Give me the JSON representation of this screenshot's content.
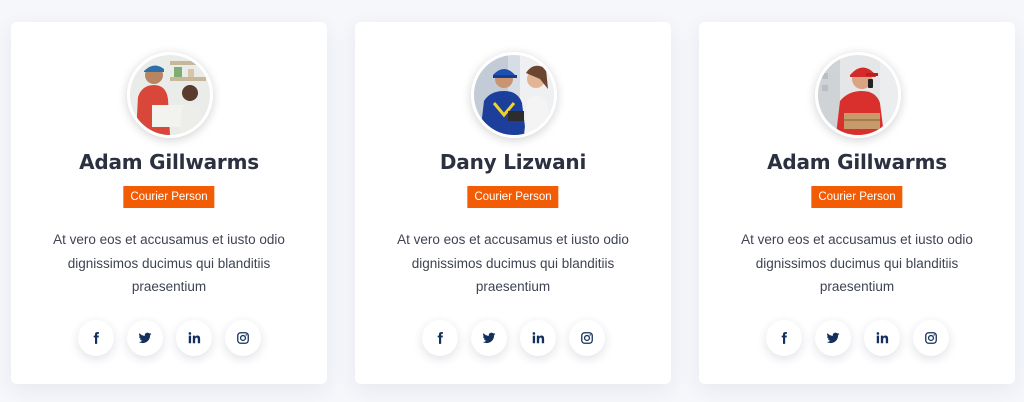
{
  "colors": {
    "accent": "#f25c05",
    "heading": "#2b3140",
    "text": "#3e4452",
    "icon": "#13305c"
  },
  "members": [
    {
      "name": "Adam Gillwarms",
      "role": "Courier Person",
      "description": "At vero eos et accusamus et iusto odio dignissimos ducimus qui blanditiis praesentium",
      "photo_icon": "courier-photo",
      "socials": [
        "facebook-icon",
        "twitter-icon",
        "linkedin-icon",
        "instagram-icon"
      ]
    },
    {
      "name": "Dany Lizwani",
      "role": "Courier Person",
      "description": "At vero eos et accusamus et iusto odio dignissimos ducimus qui blanditiis praesentium",
      "photo_icon": "courier-photo",
      "socials": [
        "facebook-icon",
        "twitter-icon",
        "linkedin-icon",
        "instagram-icon"
      ]
    },
    {
      "name": "Adam Gillwarms",
      "role": "Courier Person",
      "description": "At vero eos et accusamus et iusto odio dignissimos ducimus qui blanditiis praesentium",
      "photo_icon": "courier-photo",
      "socials": [
        "facebook-icon",
        "twitter-icon",
        "linkedin-icon",
        "instagram-icon"
      ]
    }
  ]
}
